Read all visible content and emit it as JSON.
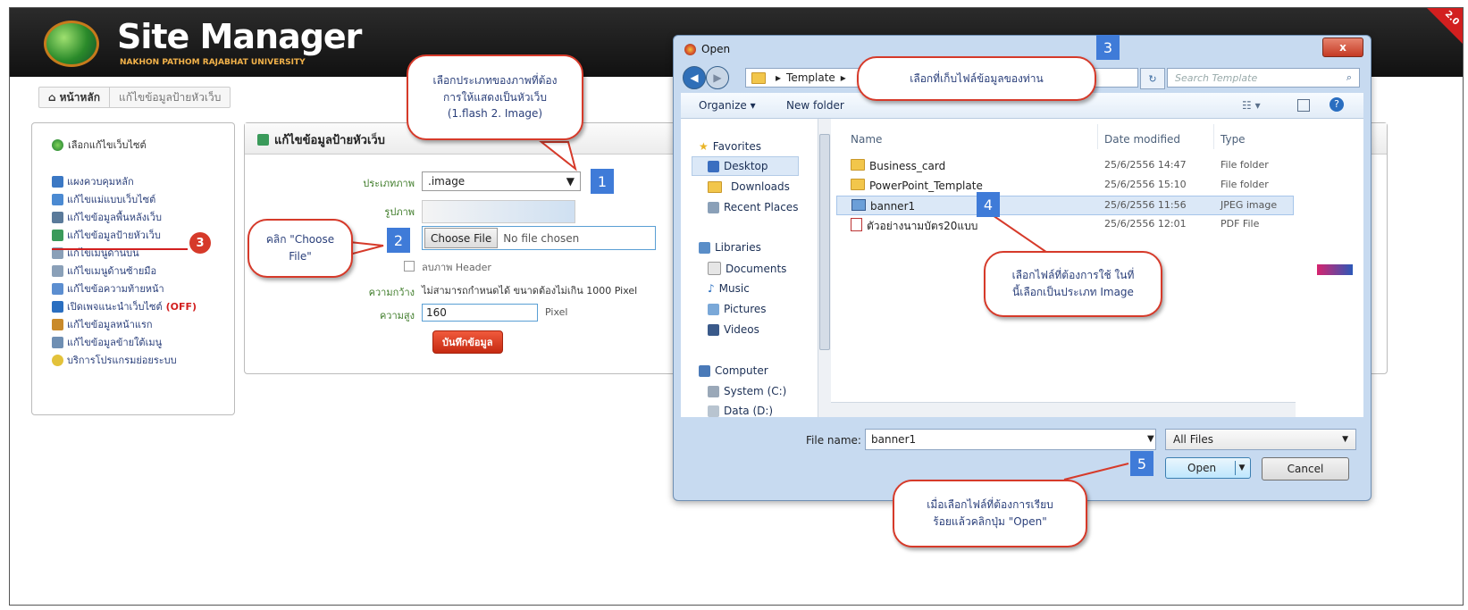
{
  "app": {
    "title": "Site Manager",
    "subtitle": "NAKHON PATHOM RAJABHAT UNIVERSITY",
    "version": "2.0"
  },
  "breadcrumb": {
    "home": "หน้าหลัก",
    "current": "แก้ไขข้อมูลป้ายหัวเว็บ"
  },
  "sidebar": {
    "select_site": "เลือกแก้ไขเว็บไซต์",
    "items": [
      {
        "label": "แผงควบคุมหลัก"
      },
      {
        "label": "แก้ไขแม่แบบเว็บไซต์"
      },
      {
        "label": "แก้ไขข้อมูลพื้นหลังเว็บ"
      },
      {
        "label": "แก้ไขข้อมูลป้ายหัวเว็บ"
      },
      {
        "label": "แก้ไขเมนูด้านบน"
      },
      {
        "label": "แก้ไขเมนูด้านซ้ายมือ"
      },
      {
        "label": "แก้ไขข้อความท้ายหน้า"
      },
      {
        "label": "เปิดเพจแนะนำเว็บไซต์",
        "badge": "(OFF)"
      },
      {
        "label": "แก้ไขข้อมูลหน้าแรก"
      },
      {
        "label": "แก้ไขข้อมูลข้ายใต้เมนู"
      },
      {
        "label": "บริการโปรแกรมย่อยระบบ"
      }
    ]
  },
  "form": {
    "title": "แก้ไขข้อมูลป้ายหัวเว็บ",
    "type_label": "ประเภทภาพ",
    "type_value": ".image",
    "image_label": "รูปภาพ",
    "choose_file": "Choose File",
    "no_file": "No file chosen",
    "remove_header": "ลบภาพ Header",
    "width_label": "ความกว้าง",
    "width_note": "ไม่สามารถกำหนดได้ ขนาดต้องไม่เกิน 1000 Pixel",
    "height_label": "ความสูง",
    "height_value": "160",
    "height_unit": "Pixel",
    "save": "บันทึกข้อมูล"
  },
  "dialog": {
    "title": "Open",
    "close": "x",
    "path_folder": "Template",
    "search_placeholder": "Search Template",
    "organize": "Organize ▾",
    "new_folder": "New folder",
    "nav": {
      "favorites": "Favorites",
      "desktop": "Desktop",
      "downloads": "Downloads",
      "recent": "Recent Places",
      "libraries": "Libraries",
      "documents": "Documents",
      "music": "Music",
      "pictures": "Pictures",
      "videos": "Videos",
      "computer": "Computer",
      "system_c": "System (C:)",
      "data_d": "Data (D:)"
    },
    "columns": {
      "name": "Name",
      "date": "Date modified",
      "type": "Type"
    },
    "files": [
      {
        "name": "Business_card",
        "date": "25/6/2556 14:47",
        "type": "File folder",
        "kind": "folder"
      },
      {
        "name": "PowerPoint_Template",
        "date": "25/6/2556 15:10",
        "type": "File folder",
        "kind": "folder"
      },
      {
        "name": "banner1",
        "date": "25/6/2556 11:56",
        "type": "JPEG image",
        "kind": "jpg"
      },
      {
        "name": "ตัวอย่างนามบัตร20แบบ",
        "date": "25/6/2556 12:01",
        "type": "PDF File",
        "kind": "pdf"
      }
    ],
    "file_name_label": "File name:",
    "file_name_value": "banner1",
    "file_type": "All Files",
    "open": "Open",
    "cancel": "Cancel"
  },
  "callouts": {
    "c1": [
      "เลือกประเภทของภาพที่ต้อง",
      "การให้แสดงเป็นหัวเว็บ",
      "(1.flash 2. Image)"
    ],
    "c2": [
      "คลิก \"Choose",
      "File\""
    ],
    "c3": [
      "เลือกที่เก็บไฟล์ข้อมูลของท่าน"
    ],
    "c4": [
      "เลือกไฟล์ที่ต้องการใช้ ในที่",
      "นี้เลือกเป็นประเภท Image"
    ],
    "c5": [
      "เมื่อเลือกไฟล์ที่ต้องการเรียบ",
      "ร้อยแล้วคลิกปุ่ม \"Open\""
    ]
  },
  "step_numbers": {
    "n1": "1",
    "n2": "2",
    "n3": "3",
    "n4": "4",
    "n5": "5",
    "side3": "3"
  },
  "colors": {
    "accent_red": "#d63a2a",
    "step_blue": "#3f7bd8",
    "header_dark": "#1c1c1c"
  }
}
